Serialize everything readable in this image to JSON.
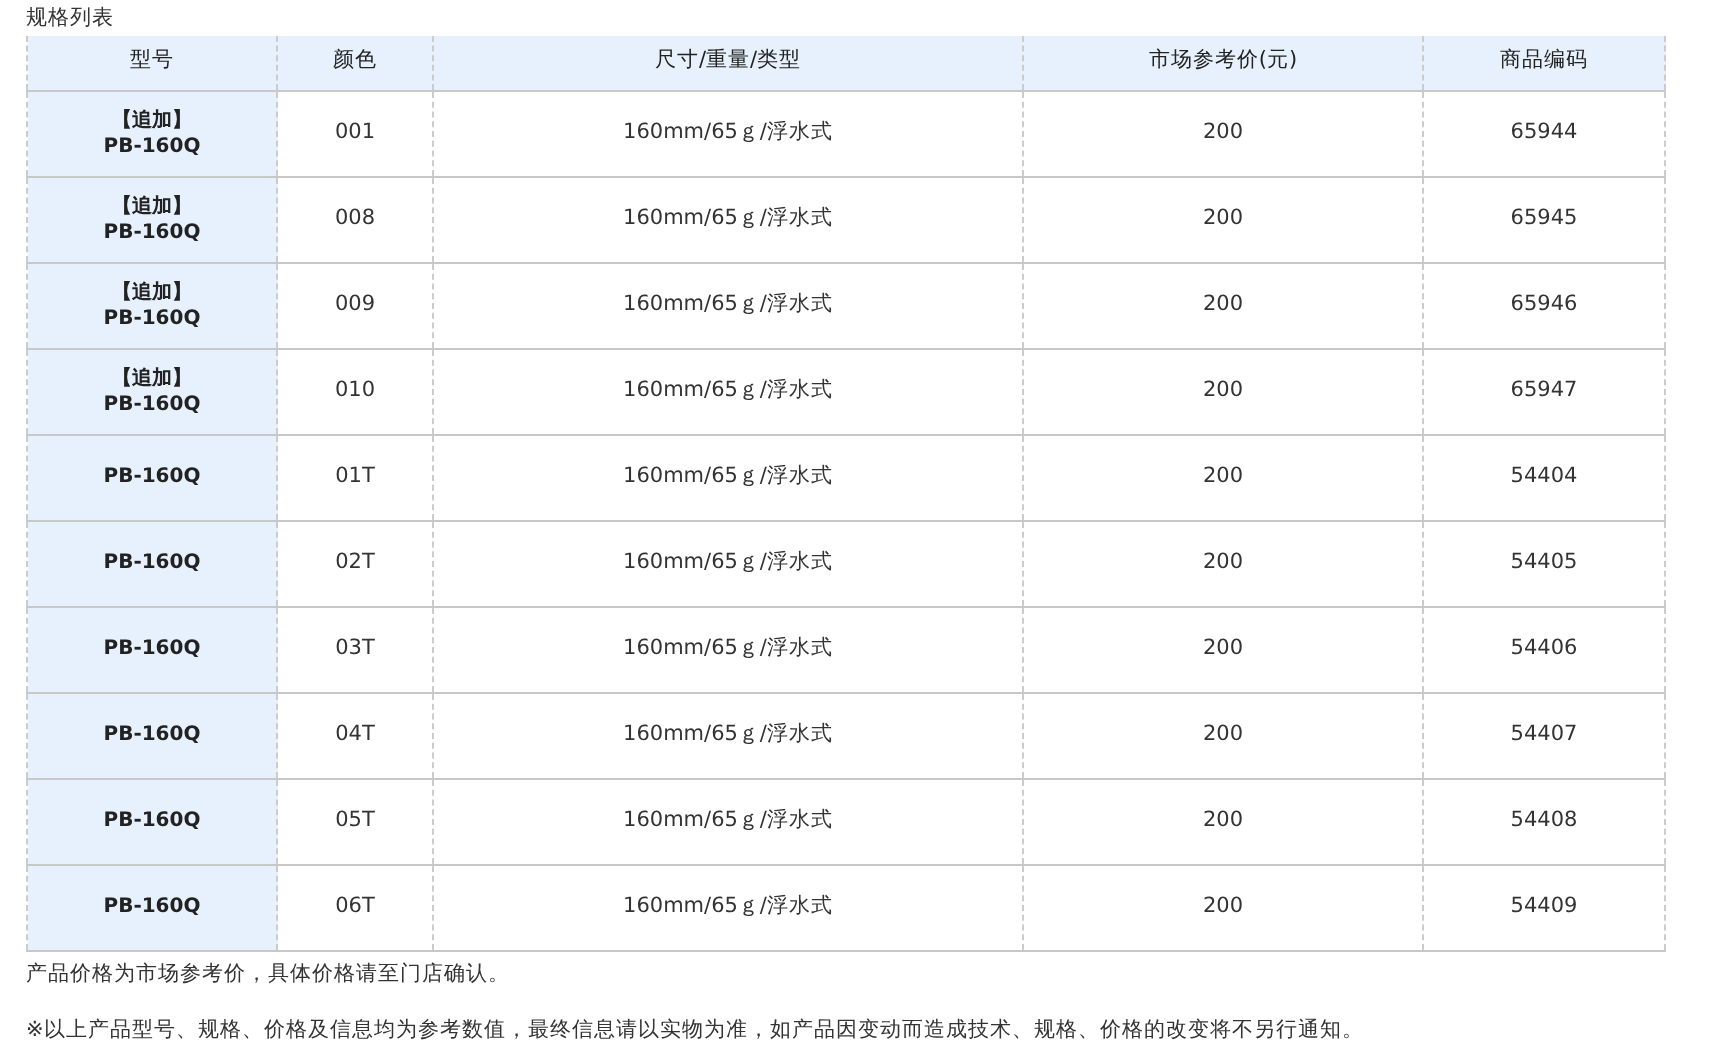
{
  "title": "规格列表",
  "table": {
    "columns": [
      "型号",
      "颜色",
      "尺寸/重量/类型",
      "市场参考价(元)",
      "商品编码"
    ],
    "rows": [
      {
        "tag": "【追加】",
        "model": "PB-160Q",
        "color_code": "001",
        "spec": "160mm/65ｇ/浮水式",
        "price": "200",
        "code": "65944"
      },
      {
        "tag": "【追加】",
        "model": "PB-160Q",
        "color_code": "008",
        "spec": "160mm/65ｇ/浮水式",
        "price": "200",
        "code": "65945"
      },
      {
        "tag": "【追加】",
        "model": "PB-160Q",
        "color_code": "009",
        "spec": "160mm/65ｇ/浮水式",
        "price": "200",
        "code": "65946"
      },
      {
        "tag": "【追加】",
        "model": "PB-160Q",
        "color_code": "010",
        "spec": "160mm/65ｇ/浮水式",
        "price": "200",
        "code": "65947"
      },
      {
        "model": "PB-160Q",
        "color_code": "01T",
        "spec": "160mm/65ｇ/浮水式",
        "price": "200",
        "code": "54404"
      },
      {
        "model": "PB-160Q",
        "color_code": "02T",
        "spec": "160mm/65ｇ/浮水式",
        "price": "200",
        "code": "54405"
      },
      {
        "model": "PB-160Q",
        "color_code": "03T",
        "spec": "160mm/65ｇ/浮水式",
        "price": "200",
        "code": "54406"
      },
      {
        "model": "PB-160Q",
        "color_code": "04T",
        "spec": "160mm/65ｇ/浮水式",
        "price": "200",
        "code": "54407"
      },
      {
        "model": "PB-160Q",
        "color_code": "05T",
        "spec": "160mm/65ｇ/浮水式",
        "price": "200",
        "code": "54408"
      },
      {
        "model": "PB-160Q",
        "color_code": "06T",
        "spec": "160mm/65ｇ/浮水式",
        "price": "200",
        "code": "54409"
      }
    ]
  },
  "notes": [
    "产品价格为市场参考价，具体价格请至门店确认。",
    "※以上产品型号、规格、价格及信息均为参考数值，最终信息请以实物为准，如产品因变动而造成技术、规格、价格的改变将不另行通知。"
  ]
}
